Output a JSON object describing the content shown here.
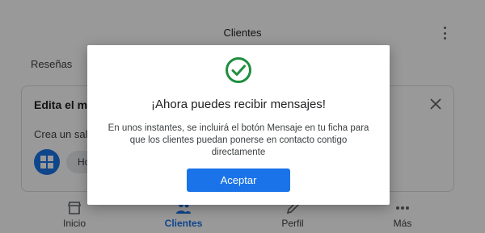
{
  "header": {
    "title": "Clientes",
    "menu_icon": "more-vert-icon"
  },
  "section": {
    "label": "Reseñas"
  },
  "card": {
    "heading": "Edita el me",
    "subtitle": "Crea un salu",
    "chip_label": "Ho",
    "close_icon": "close-icon",
    "thumb_icon": "grid-thumbnail-icon"
  },
  "bottom_nav": [
    {
      "label": "Inicio",
      "icon": "storefront-icon"
    },
    {
      "label": "Clientes",
      "icon": "people-icon",
      "active": true
    },
    {
      "label": "Perfil",
      "icon": "pencil-icon"
    },
    {
      "label": "Más",
      "icon": "more-horiz-icon"
    }
  ],
  "dialog": {
    "icon": "check-circle-icon",
    "title": "¡Ahora puedes recibir mensajes!",
    "body": "En unos instantes, se incluirá el botón Mensaje en tu ficha para que los clientes puedan ponerse en contacto contigo directamente",
    "accept_label": "Aceptar"
  },
  "colors": {
    "accent": "#1a73e8",
    "success": "#1e8e3e",
    "scrim": "rgba(0,0,0,0.40)"
  }
}
